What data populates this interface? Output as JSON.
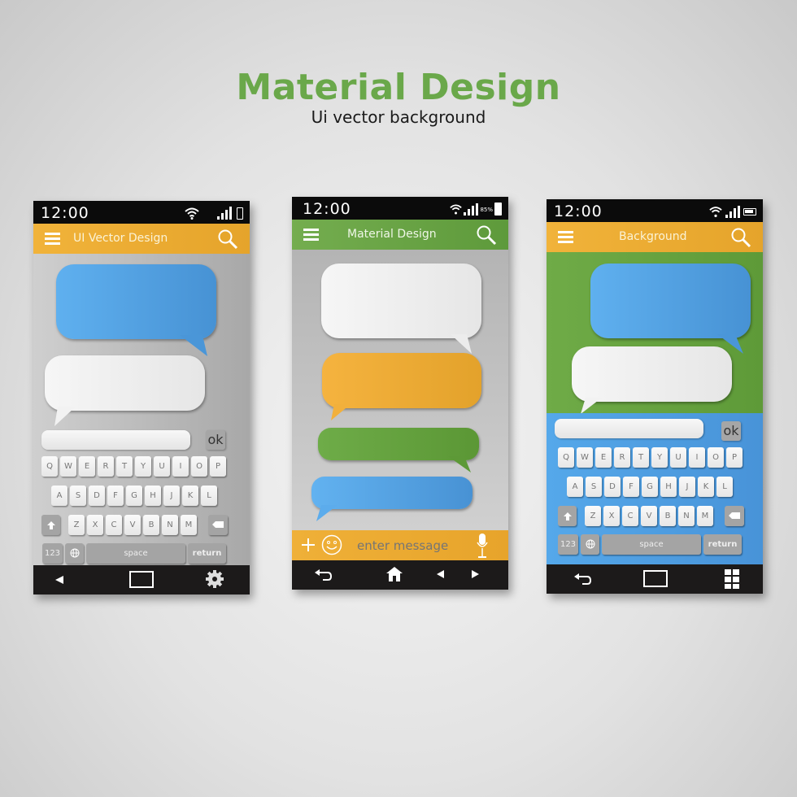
{
  "header": {
    "title": "Material Design",
    "subtitle": "Ui vector background"
  },
  "colors": {
    "green": "#6aa84a",
    "orange": "#eaa930",
    "blue": "#4da0e0",
    "white_bubble": "#eeeeee",
    "status_bar": "#0b0b0b",
    "nav_bar": "#1c1a1a"
  },
  "phones": [
    {
      "status": {
        "time": "12:00",
        "icons": [
          "wifi-icon",
          "signal-icon",
          "battery-icon"
        ]
      },
      "appbar": {
        "title": "UI Vector Design",
        "color": "#eaa930"
      },
      "bubbles": [
        "blue-bubble",
        "white-bubble"
      ],
      "keyboard": {
        "ok_label": "ok",
        "row1": [
          "Q",
          "W",
          "E",
          "R",
          "T",
          "Y",
          "U",
          "I",
          "O",
          "P"
        ],
        "row2": [
          "A",
          "S",
          "D",
          "F",
          "G",
          "H",
          "J",
          "K",
          "L"
        ],
        "row3": [
          "Z",
          "X",
          "C",
          "V",
          "B",
          "N",
          "M"
        ],
        "numbers_label": "123",
        "space_label": "space",
        "return_label": "return"
      },
      "nav": [
        "back-icon",
        "home-square-icon",
        "gear-icon"
      ]
    },
    {
      "status": {
        "time": "12:00",
        "battery_text": "85%",
        "icons": [
          "wifi-icon",
          "signal-icon",
          "battery-icon"
        ]
      },
      "appbar": {
        "title": "Material Design",
        "color": "#6aa84a"
      },
      "bubbles": [
        "white-bubble",
        "orange-bubble",
        "green-bubble",
        "blue-bubble"
      ],
      "message_bar": {
        "placeholder": "enter message",
        "icons": [
          "plus-icon",
          "smiley-icon",
          "microphone-icon"
        ]
      },
      "nav": [
        "return-icon",
        "home-icon",
        "prev-icon",
        "next-icon"
      ]
    },
    {
      "status": {
        "time": "12:00",
        "icons": [
          "wifi-icon",
          "signal-icon",
          "battery-icon"
        ]
      },
      "appbar": {
        "title": "Background",
        "color": "#eaa930"
      },
      "bubbles": [
        "blue-bubble",
        "white-bubble"
      ],
      "keyboard": {
        "ok_label": "ok",
        "row1": [
          "Q",
          "W",
          "E",
          "R",
          "T",
          "Y",
          "U",
          "I",
          "O",
          "P"
        ],
        "row2": [
          "A",
          "S",
          "D",
          "F",
          "G",
          "H",
          "J",
          "K",
          "L"
        ],
        "row3": [
          "Z",
          "X",
          "C",
          "V",
          "B",
          "N",
          "M"
        ],
        "numbers_label": "123",
        "space_label": "space",
        "return_label": "return"
      },
      "nav": [
        "return-icon",
        "home-square-icon",
        "apps-grid-icon"
      ]
    }
  ]
}
